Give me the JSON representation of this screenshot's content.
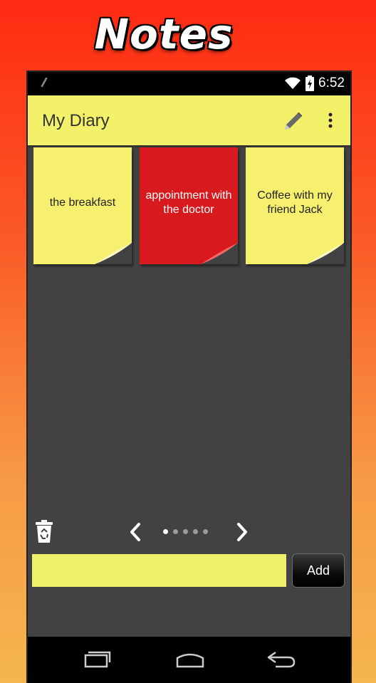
{
  "promo": {
    "title": "Notes"
  },
  "status_bar": {
    "time": "6:52"
  },
  "app_bar": {
    "title": "My Diary",
    "icons": [
      "pencil-icon",
      "overflow-menu-icon"
    ]
  },
  "notes": [
    {
      "text": "the breakfast",
      "color": "#f6f06e"
    },
    {
      "text": "appointment with the doctor",
      "color": "#d8191d"
    },
    {
      "text": "Coffee with my friend Jack",
      "color": "#f6f06e"
    }
  ],
  "pager": {
    "page_count": 5,
    "current_page": 1
  },
  "composer": {
    "input_value": "",
    "add_label": "Add"
  },
  "colors": {
    "accent": "#f3f06a",
    "background": "#424242",
    "status_bar": "#000000"
  }
}
